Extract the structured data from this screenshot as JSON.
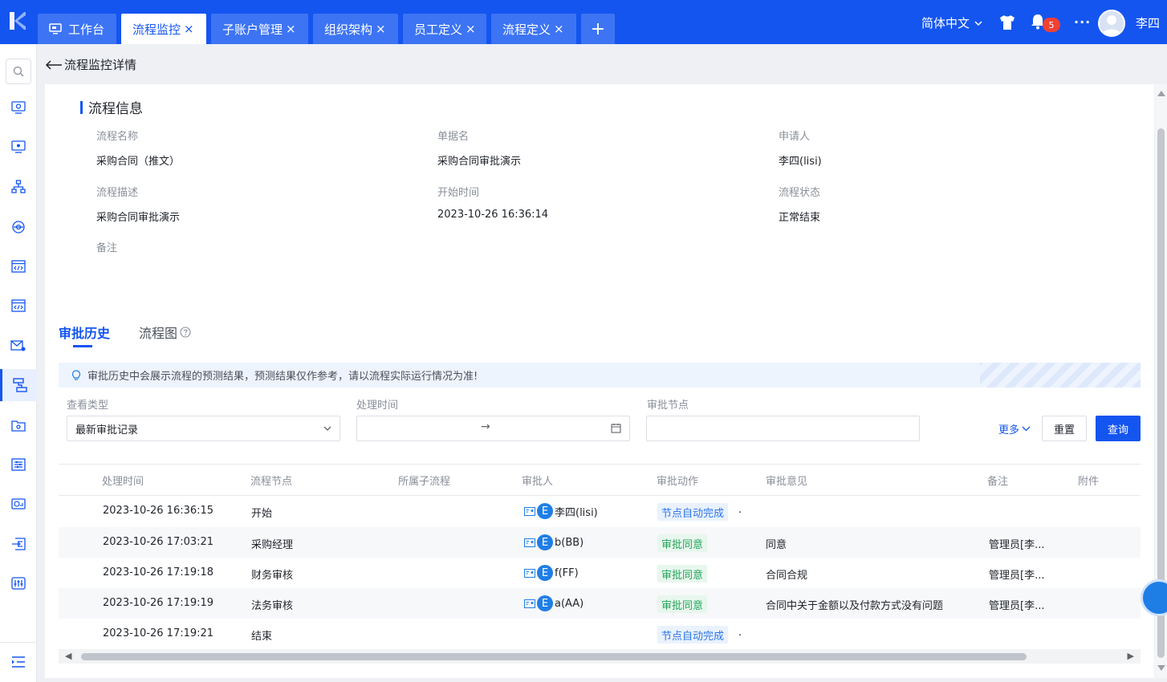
{
  "tabs": [
    {
      "label": "工作台",
      "icon": "desktop-icon",
      "closable": false,
      "active": false
    },
    {
      "label": "流程监控",
      "closable": true,
      "active": true
    },
    {
      "label": "子账户管理",
      "closable": true,
      "active": false
    },
    {
      "label": "组织架构",
      "closable": true,
      "active": false
    },
    {
      "label": "员工定义",
      "closable": true,
      "active": false
    },
    {
      "label": "流程定义",
      "closable": true,
      "active": false
    }
  ],
  "tab_add": "+",
  "tab_close": "×",
  "header": {
    "language": "简体中文",
    "notification_count": "5",
    "user_name": "李四",
    "more_dots": "···"
  },
  "page": {
    "back_title": "流程监控详情"
  },
  "process_info": {
    "title": "流程信息",
    "fields": {
      "process_name_label": "流程名称",
      "process_name": "采购合同（推文）",
      "doc_name_label": "单据名",
      "doc_name": "采购合同审批演示",
      "applicant_label": "申请人",
      "applicant": "李四(lisi)",
      "desc_label": "流程描述",
      "desc": "采购合同审批演示",
      "start_time_label": "开始时间",
      "start_time": "2023-10-26 16:36:14",
      "status_label": "流程状态",
      "status": "正常结束",
      "remark_label": "备注"
    }
  },
  "detail_tabs": {
    "history": "审批历史",
    "diagram": "流程图"
  },
  "notice": "审批历史中会展示流程的预测结果，预测结果仅作参考，请以流程实际运行情况为准!",
  "filters": {
    "view_type_label": "查看类型",
    "view_type_value": "最新审批记录",
    "process_time_label": "处理时间",
    "range_sep": "→",
    "node_label": "审批节点",
    "more": "更多",
    "reset": "重置",
    "query": "查询"
  },
  "table": {
    "columns": [
      "处理时间",
      "流程节点",
      "所属子流程",
      "审批人",
      "审批动作",
      "审批意见",
      "备注",
      "附件"
    ],
    "rows": [
      {
        "time": "2023-10-26 16:36:15",
        "node": "开始",
        "approver": "李四(lisi)",
        "action": "节点自动完成",
        "action_type": "auto",
        "opinion": "",
        "remark": ""
      },
      {
        "time": "2023-10-26 17:03:21",
        "node": "采购经理",
        "approver": "b(BB)",
        "action": "审批同意",
        "action_type": "ok",
        "opinion": "同意",
        "remark": "管理员[李..."
      },
      {
        "time": "2023-10-26 17:19:18",
        "node": "财务审核",
        "approver": "f(FF)",
        "action": "审批同意",
        "action_type": "ok",
        "opinion": "合同合规",
        "remark": "管理员[李..."
      },
      {
        "time": "2023-10-26 17:19:19",
        "node": "法务审核",
        "approver": "a(AA)",
        "action": "审批同意",
        "action_type": "ok",
        "opinion": "合同中关于金额以及付款方式没有问题",
        "remark": "管理员[李..."
      },
      {
        "time": "2023-10-26 17:19:21",
        "node": "结束",
        "approver": "",
        "action": "节点自动完成",
        "action_type": "auto",
        "opinion": "",
        "remark": ""
      }
    ],
    "approver_badge": "E",
    "dot": "."
  },
  "colors": {
    "brand": "#1455f0",
    "auto_tag": "#2d76e8",
    "ok_tag": "#23a55a",
    "badge": "#f04134"
  }
}
